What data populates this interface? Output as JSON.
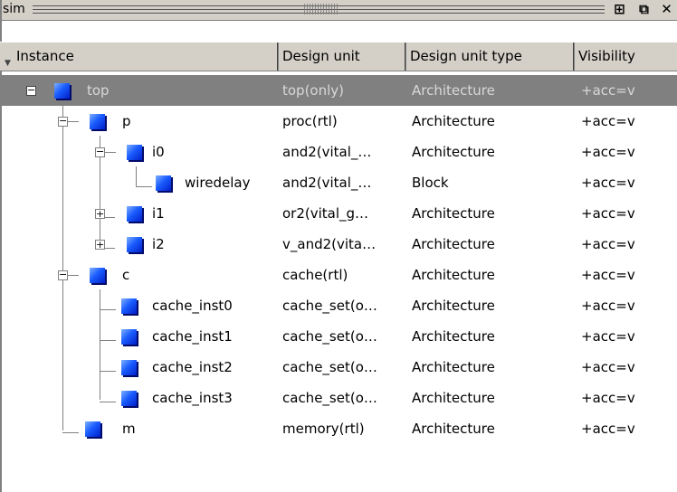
{
  "window": {
    "title": "sim"
  },
  "columns": [
    {
      "label": "Instance"
    },
    {
      "label": "Design unit"
    },
    {
      "label": "Design unit type"
    },
    {
      "label": "Visibility"
    }
  ],
  "rows": [
    {
      "name": "top",
      "unit": "top(only)",
      "type": "Architecture",
      "vis": "+acc=v",
      "expander": "minus",
      "selected": true
    },
    {
      "name": "p",
      "unit": "proc(rtl)",
      "type": "Architecture",
      "vis": "+acc=v",
      "expander": "minus"
    },
    {
      "name": "i0",
      "unit": "and2(vital_…",
      "type": "Architecture",
      "vis": "+acc=v",
      "expander": "minus"
    },
    {
      "name": "wiredelay",
      "unit": "and2(vital_…",
      "type": "Block",
      "vis": "+acc=v"
    },
    {
      "name": "i1",
      "unit": "or2(vital_g…",
      "type": "Architecture",
      "vis": "+acc=v",
      "expander": "plus"
    },
    {
      "name": "i2",
      "unit": "v_and2(vita…",
      "type": "Architecture",
      "vis": "+acc=v",
      "expander": "plus"
    },
    {
      "name": "c",
      "unit": "cache(rtl)",
      "type": "Architecture",
      "vis": "+acc=v",
      "expander": "minus"
    },
    {
      "name": "cache_inst0",
      "unit": "cache_set(o…",
      "type": "Architecture",
      "vis": "+acc=v"
    },
    {
      "name": "cache_inst1",
      "unit": "cache_set(o…",
      "type": "Architecture",
      "vis": "+acc=v"
    },
    {
      "name": "cache_inst2",
      "unit": "cache_set(o…",
      "type": "Architecture",
      "vis": "+acc=v"
    },
    {
      "name": "cache_inst3",
      "unit": "cache_set(o…",
      "type": "Architecture",
      "vis": "+acc=v"
    },
    {
      "name": "m",
      "unit": "memory(rtl)",
      "type": "Architecture",
      "vis": "+acc=v"
    }
  ],
  "icons": {
    "sort": "sort-arrow-icon",
    "instance": "instance-icon",
    "dock": "dock-icon",
    "undock": "undock-icon",
    "close": "close-icon"
  }
}
